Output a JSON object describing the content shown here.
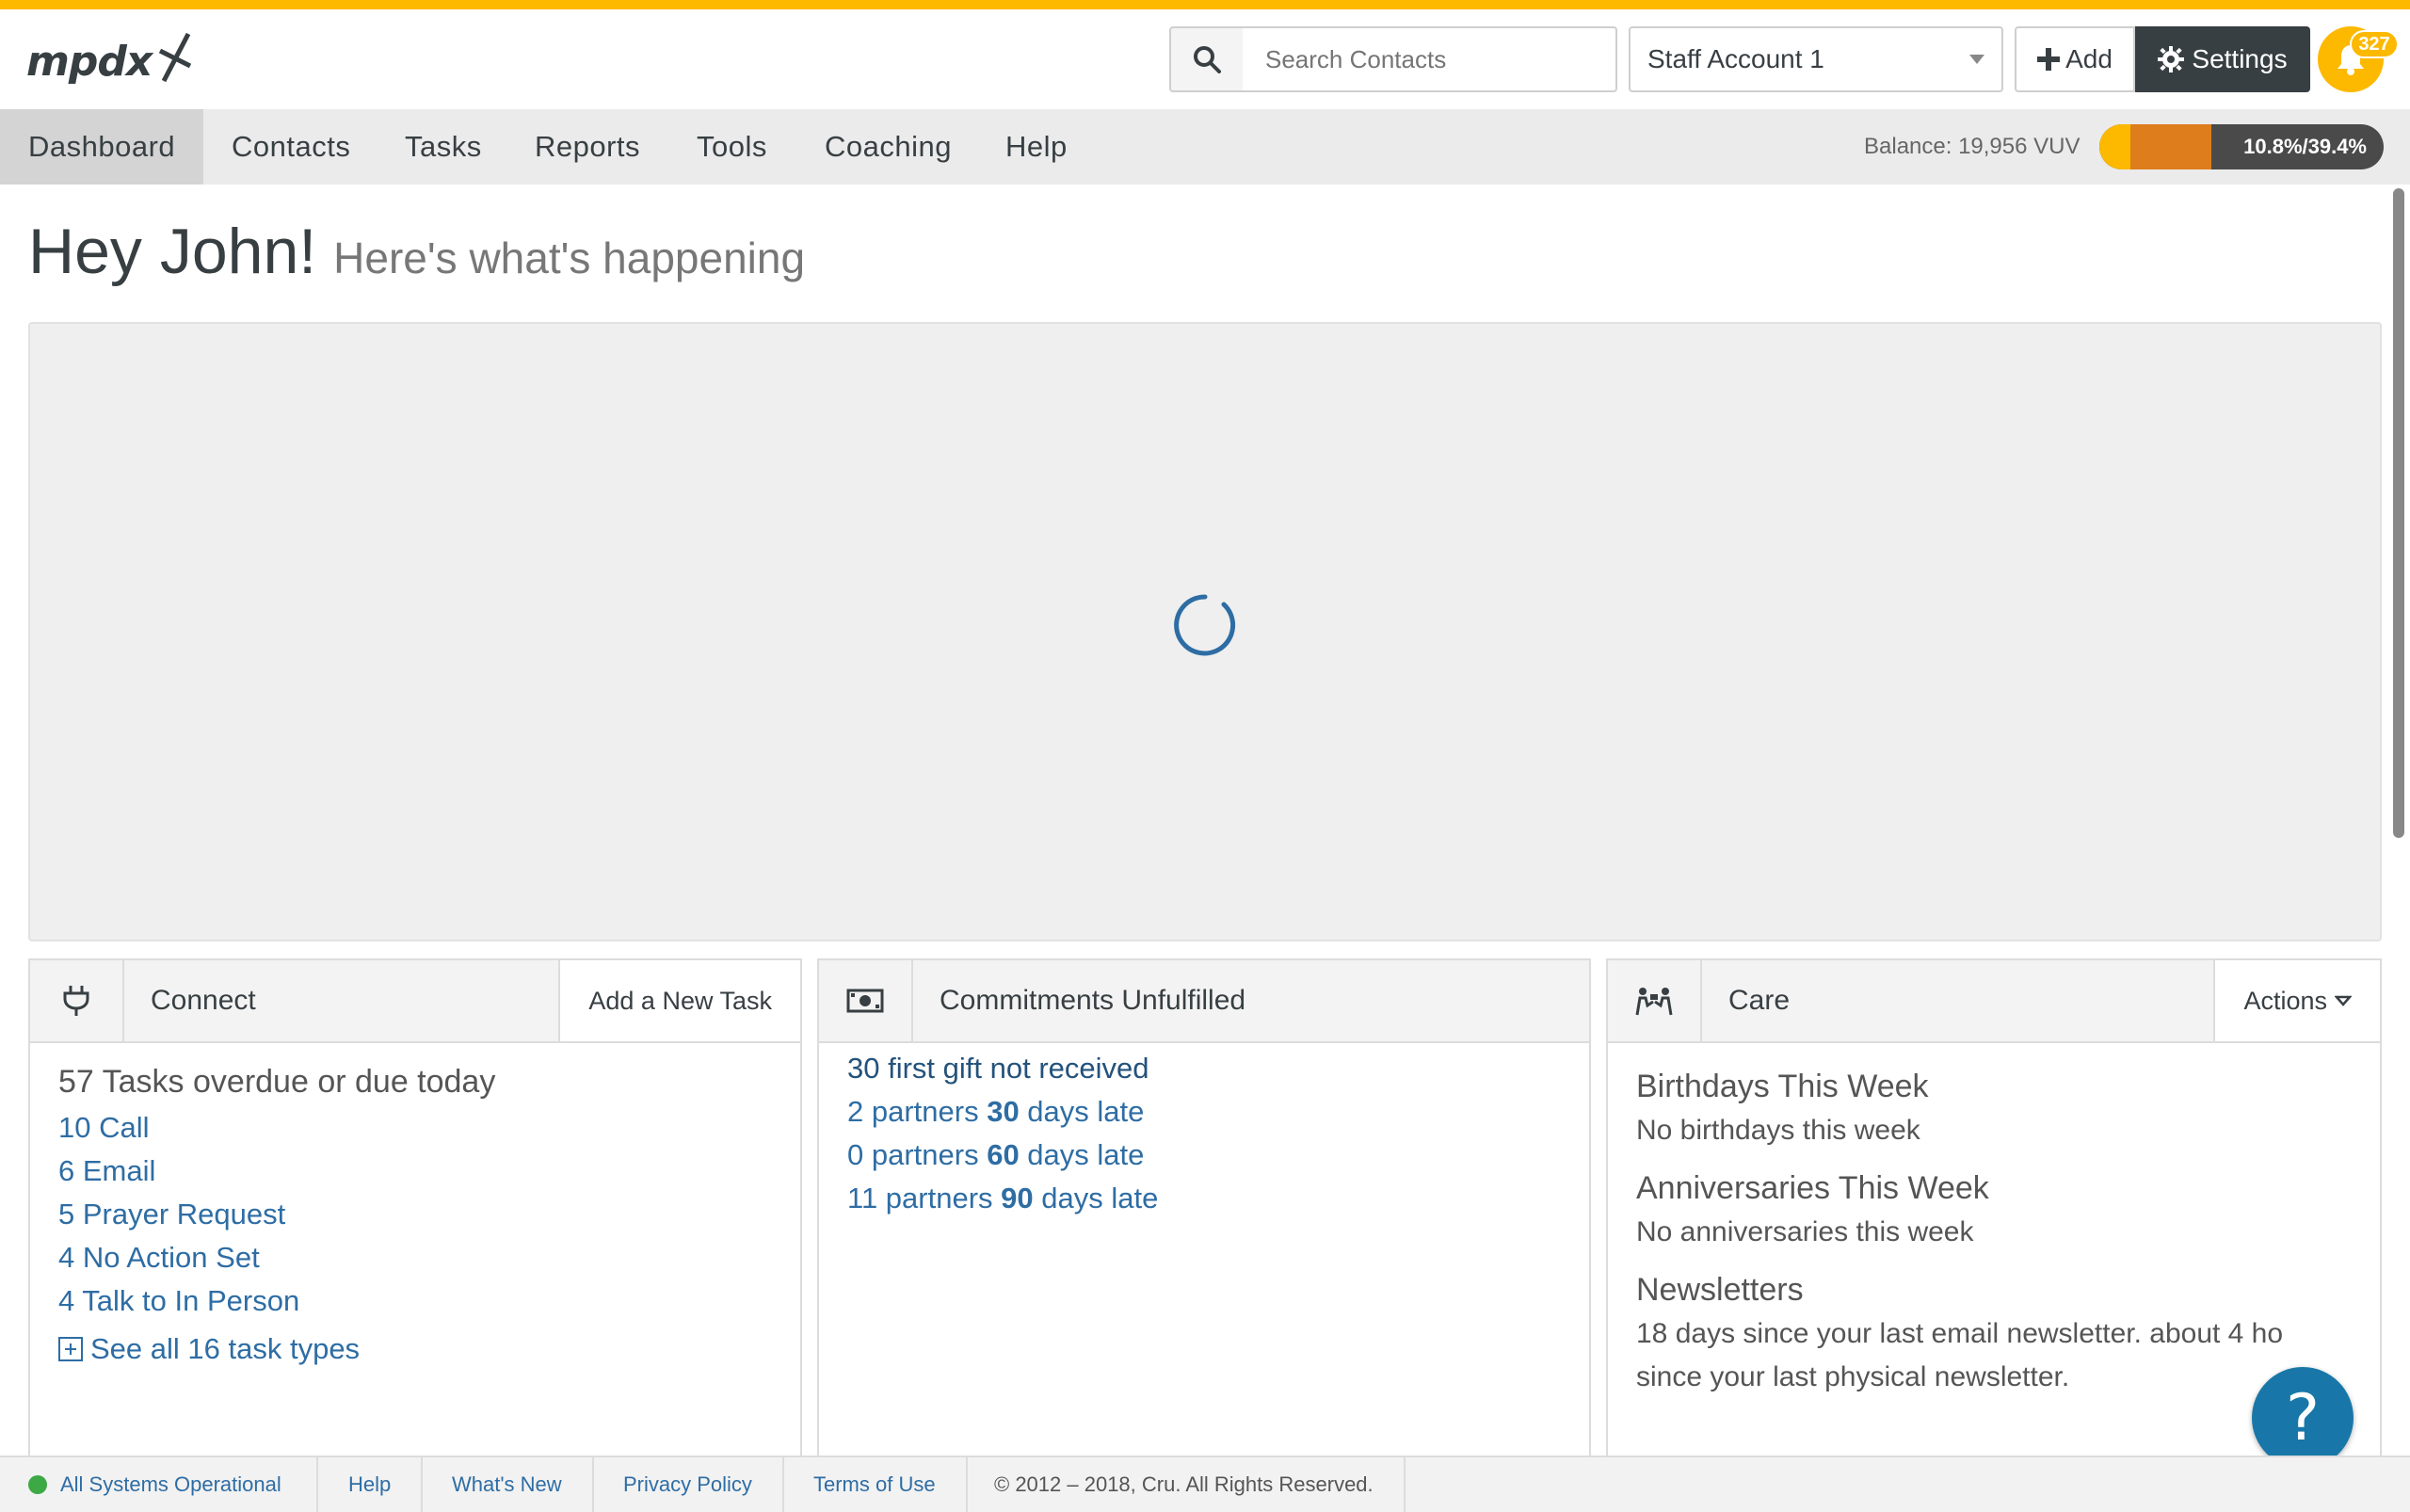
{
  "app": {
    "logo_text": "mpdx",
    "brand_color": "#fdb800",
    "dark_color": "#383f43"
  },
  "header": {
    "search": {
      "placeholder": "Search Contacts",
      "icon": "search-icon"
    },
    "account_select": {
      "selected": "Staff Account 1"
    },
    "add_label": "Add",
    "settings_label": "Settings",
    "notifications_count": "327"
  },
  "nav": {
    "items": [
      "Dashboard",
      "Contacts",
      "Tasks",
      "Reports",
      "Tools",
      "Coaching",
      "Help"
    ],
    "active": "Dashboard",
    "balance": "Balance: 19,956 VUV",
    "progress": {
      "label": "10.8%/39.4%",
      "primary_pct": 10.8,
      "secondary_pct": 39.4,
      "primary_color": "#fdb800",
      "secondary_color": "#dd7d1b"
    }
  },
  "greeting": {
    "title": "Hey John!",
    "subtitle": "Here's what's happening"
  },
  "connect": {
    "title": "Connect",
    "action": "Add a New Task",
    "lead": "57 Tasks overdue or due today",
    "tasks": [
      "10 Call",
      "6 Email",
      "5 Prayer Request",
      "4 No Action Set",
      "4 Talk to In Person"
    ],
    "see_all": "See all 16 task types"
  },
  "commitments": {
    "title": "Commitments Unfulfilled",
    "first_gift": "30 first gift not received",
    "late": [
      {
        "prefix": "2 partners ",
        "days": "30",
        "suffix": " days late"
      },
      {
        "prefix": "0 partners ",
        "days": "60",
        "suffix": " days late"
      },
      {
        "prefix": "11 partners ",
        "days": "90",
        "suffix": " days late"
      }
    ]
  },
  "care": {
    "title": "Care",
    "action": "Actions",
    "birthdays_h": "Birthdays This Week",
    "birthdays_p": "No birthdays this week",
    "anniversaries_h": "Anniversaries This Week",
    "anniversaries_p": "No anniversaries this week",
    "newsletters_h": "Newsletters",
    "newsletters_p": "18 days since your last email newsletter. about 4 ho since your last physical newsletter."
  },
  "help_fab": "?",
  "footer": {
    "status": "All Systems Operational",
    "help": "Help",
    "whats_new": "What's New",
    "privacy": "Privacy Policy",
    "terms": "Terms of Use",
    "copyright": "© 2012 – 2018, Cru. All Rights Reserved."
  }
}
